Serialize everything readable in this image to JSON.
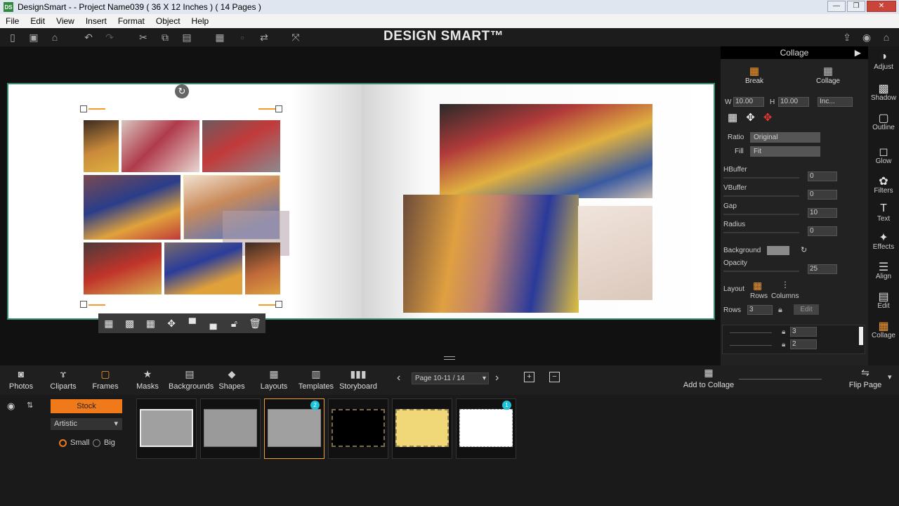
{
  "window": {
    "app_icon": "DS",
    "title": "DesignSmart -  - Project Name039 ( 36 X 12 Inches ) ( 14 Pages )",
    "controls": [
      "minimize",
      "maximize",
      "close"
    ]
  },
  "menu": {
    "items": [
      "File",
      "Edit",
      "View",
      "Insert",
      "Format",
      "Object",
      "Help"
    ]
  },
  "toolbar": {
    "brand": "DESIGN SMART™"
  },
  "canvas": {
    "rotate_glyph": "↻"
  },
  "panel": {
    "header": "Collage",
    "break_label": "Break",
    "collage_label": "Collage",
    "w_label": "W",
    "w_value": "10.00",
    "h_label": "H",
    "h_value": "10.00",
    "unit_value": "Inc...",
    "ratio_label": "Ratio",
    "ratio_value": "Original",
    "fill_label": "Fill",
    "fill_value": "Fit",
    "hbuffer_label": "HBuffer",
    "hbuffer_value": "0",
    "vbuffer_label": "VBuffer",
    "vbuffer_value": "0",
    "gap_label": "Gap",
    "gap_value": "10",
    "radius_label": "Radius",
    "radius_value": "0",
    "background_label": "Background",
    "opacity_label": "Opacity",
    "opacity_value": "25",
    "layout_label": "Layout",
    "rows_col_label": "Rows",
    "columns_col_label": "Columns",
    "rows_label": "Rows",
    "rows_value": "3",
    "edit_label": "Edit",
    "row1_value": "3",
    "row2_value": "2"
  },
  "sidebar": {
    "items": [
      "Adjust",
      "Shadow",
      "Outline",
      "Glow",
      "Filters",
      "Text",
      "Effects",
      "Align",
      "Edit",
      "Collage"
    ]
  },
  "bottom_tabs": {
    "items": [
      "Photos",
      "Cliparts",
      "Frames",
      "Masks",
      "Backgrounds",
      "Shapes",
      "Layouts",
      "Templates",
      "Storyboard"
    ],
    "active": "Frames",
    "page_selector": "Page 10-11 / 14",
    "add_to_collage": "Add to Collage",
    "flip_page": "Flip Page"
  },
  "frames_panel": {
    "stock_label": "Stock",
    "category_value": "Artistic",
    "size_small": "Small",
    "size_big": "Big",
    "selected_size": "Small",
    "badge_1": "2",
    "badge_2": "1"
  }
}
